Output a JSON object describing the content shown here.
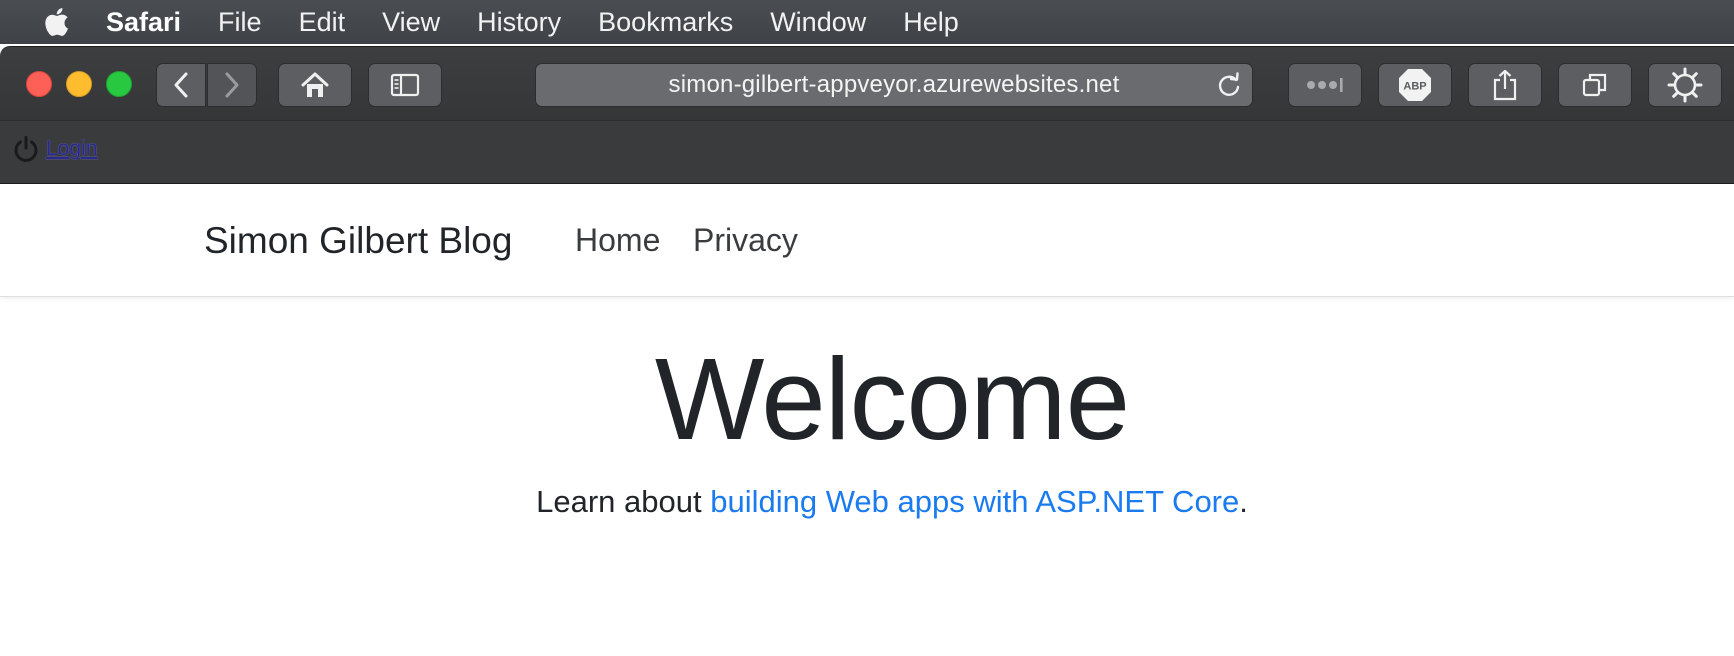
{
  "menubar": {
    "app_name": "Safari",
    "items": [
      "File",
      "Edit",
      "View",
      "History",
      "Bookmarks",
      "Window",
      "Help"
    ]
  },
  "toolbar": {
    "address": "simon-gilbert-appveyor.azurewebsites.net",
    "abp_label": "ABP"
  },
  "favorites": {
    "login_label": "Login"
  },
  "site": {
    "brand": "Simon Gilbert Blog",
    "nav": [
      "Home",
      "Privacy"
    ],
    "heading": "Welcome",
    "learn_prefix": "Learn about ",
    "learn_link": "building Web apps with ASP.NET Core",
    "learn_suffix": "."
  },
  "colors": {
    "link": "#1a7bf0",
    "traffic_red": "#fe5f57",
    "traffic_yellow": "#febc2e",
    "traffic_green": "#28c840"
  }
}
